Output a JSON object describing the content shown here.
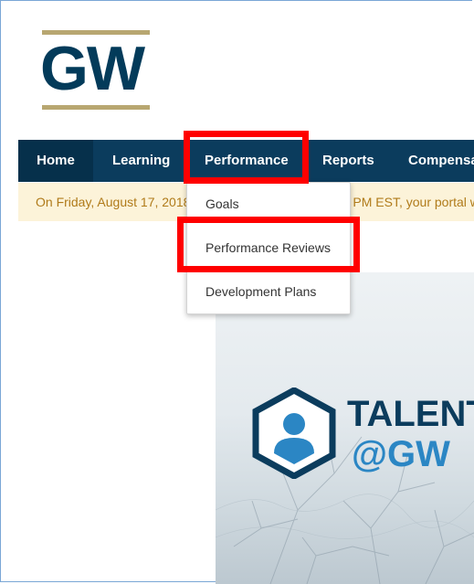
{
  "logo": {
    "text": "GW"
  },
  "nav": {
    "items": [
      {
        "label": "Home"
      },
      {
        "label": "Learning"
      },
      {
        "label": "Performance"
      },
      {
        "label": "Reports"
      },
      {
        "label": "Compensa"
      }
    ]
  },
  "notice": {
    "text_left": "On Friday, August 17, 2018",
    "text_right": "PM EST, your portal w"
  },
  "dropdown": {
    "items": [
      {
        "label": "Goals"
      },
      {
        "label": "Performance Reviews"
      },
      {
        "label": "Development Plans"
      }
    ]
  },
  "banner": {
    "title_line1": "TALENT",
    "title_line2": "@GW"
  },
  "colors": {
    "nav_bg": "#0b3c5d",
    "highlight": "#ff0000",
    "notice_bg": "#fcf3d9",
    "notice_text": "#b07b1a",
    "brand_gold": "#b8a771",
    "brand_blue": "#2b86c4"
  }
}
